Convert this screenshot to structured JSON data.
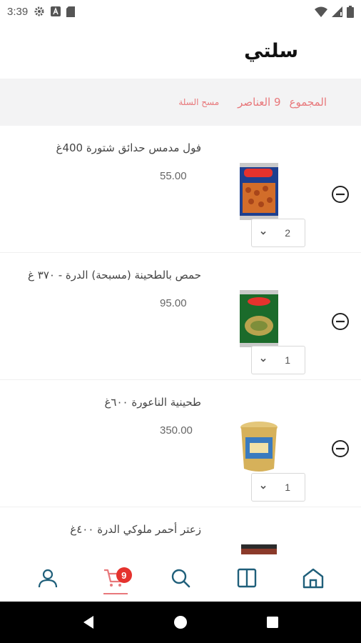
{
  "status_bar": {
    "time": "3:39",
    "icons": [
      "settings-icon",
      "font-icon",
      "sd-card-icon",
      "wifi-icon",
      "signal-icon",
      "battery-icon"
    ]
  },
  "header": {
    "title": "سلتي"
  },
  "summary": {
    "total_label": "المجموع",
    "count_label": "9 العناصر",
    "clear_label": "مسح السلة"
  },
  "items": [
    {
      "name": "فول مدمس حدائق شتورة 400غ",
      "price": "55.00",
      "qty": "2",
      "image_icon": "can-beans-icon"
    },
    {
      "name": "حمص بالطحينة (مسبحة) الدرة - ٣٧٠ غ",
      "price": "95.00",
      "qty": "1",
      "image_icon": "can-hummus-icon"
    },
    {
      "name": "طحينية الناعورة ٦٠٠غ",
      "price": "350.00",
      "qty": "1",
      "image_icon": "tahini-tub-icon"
    },
    {
      "name": "زعتر أحمر ملوكي الدرة ٤٠٠غ",
      "price": "",
      "qty": "",
      "image_icon": "zaatar-jar-icon"
    }
  ],
  "bottom_nav": {
    "items": [
      "profile-icon",
      "cart-icon",
      "search-icon",
      "categories-icon",
      "home-icon"
    ],
    "cart_badge": "9"
  },
  "colors": {
    "accent": "#e8787b",
    "badge": "#e5322d",
    "nav_icon": "#1f5f7a"
  }
}
